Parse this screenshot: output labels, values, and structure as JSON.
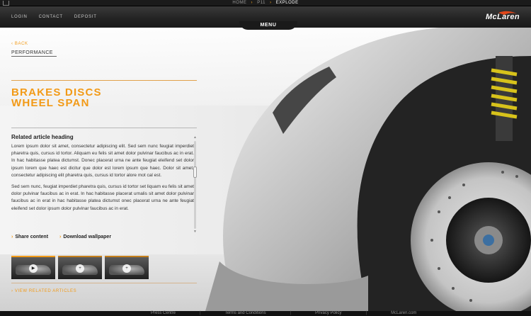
{
  "breadcrumb": {
    "home": "HOME",
    "p11": "P11",
    "current": "EXPLODE"
  },
  "nav": {
    "login": "LOGIN",
    "contact": "CONTACT",
    "deposit": "DEPOSIT"
  },
  "brand": {
    "name": "McLaren"
  },
  "menu": {
    "label": "MENU"
  },
  "panel": {
    "back": "‹ BACK",
    "section": "PERFORMANCE",
    "title_line1": "BRAKES DISCS",
    "title_line2": "WHEEL SPAN"
  },
  "article": {
    "heading": "Related article heading",
    "paragraph1": "Lorem ipsum dolor sit amet, consectetur adipiscing elit. Sed sem nunc feugiat imperdiet pharetra quis, cursus id tortor. Aliquam eu felis sit amet dolor pulvinar faucibus ac in erat. In hac habitasse platea dictumst. Donec placerat urna ne ante feugiat eleifend set dolor ipsum lorem que haec est dicitur que dolor est lorem ipsum que haec. Dolor sit amet, consectetur adipiscing elit pharetra quis, cursus id tortor alore mot cal est.",
    "paragraph2": "Sed sem nunc, feugiat imperdiet pharetra quis, cursus id tortor set liquam eu felis sit amet dolor pulvinar faucibus ac in erat. In hac habitasse placerat urnalis sit amet dolor pulvinar faucibus ac in erat in hac habitasse platea dictumst onec placerat urna ne ante feugiat eleifend set dolor ipsum dolor pulvinar faucibus ac in erat."
  },
  "actions": {
    "share": "Share content",
    "download": "Download wallpaper"
  },
  "related": {
    "label": "› VIEW RELATED ARTICLES"
  },
  "footer": {
    "press": "Press Centre",
    "terms": "Terms and Conditions",
    "privacy": "Privacy Policy",
    "site": "McLaren.com"
  },
  "colors": {
    "accent": "#f29a17",
    "dark": "#1b1b1b",
    "caliper": "#d7c21b"
  },
  "icons": {
    "play": "play-icon",
    "plus": "plus-icon",
    "chevron": "chevron-right-icon"
  }
}
